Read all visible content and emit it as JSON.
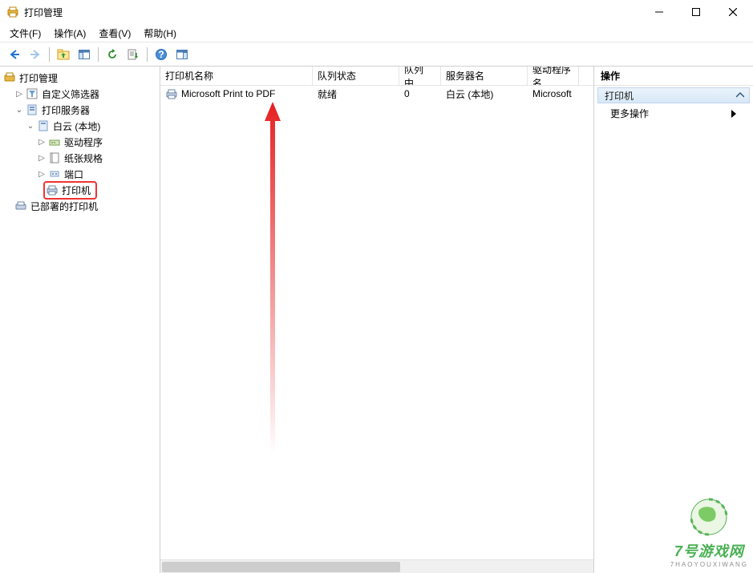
{
  "window": {
    "title": "打印管理",
    "minimize_tip": "最小化",
    "maximize_tip": "最大化",
    "close_tip": "关闭"
  },
  "menubar": {
    "file": "文件(F)",
    "action": "操作(A)",
    "view": "查看(V)",
    "help": "帮助(H)"
  },
  "toolbar": {
    "back_tip": "后退",
    "forward_tip": "前进",
    "up_tip": "上一级",
    "show_hide_tip": "显示/隐藏控制台树",
    "refresh_tip": "刷新",
    "export_tip": "导出列表",
    "help_tip": "帮助",
    "pane_tip": "显示/隐藏操作窗格"
  },
  "tree": {
    "root": "打印管理",
    "custom_filters": "自定义筛选器",
    "print_servers": "打印服务器",
    "local_server": "白云 (本地)",
    "drivers": "驱动程序",
    "paper": "纸张规格",
    "ports": "端口",
    "printers": "打印机",
    "deployed": "已部署的打印机"
  },
  "list": {
    "columns": {
      "name": "打印机名称",
      "status": "队列状态",
      "queue": "队列中...",
      "server": "服务器名",
      "driver": "驱动程序名"
    },
    "rows": [
      {
        "name": "Microsoft Print to PDF",
        "status": "就绪",
        "queue": "0",
        "server": "白云 (本地)",
        "driver": "Microsoft"
      }
    ]
  },
  "actions": {
    "header": "操作",
    "section": "打印机",
    "more": "更多操作"
  },
  "watermark": {
    "main": "7号游戏网",
    "sub": "7HAOYOUXIWANG"
  }
}
